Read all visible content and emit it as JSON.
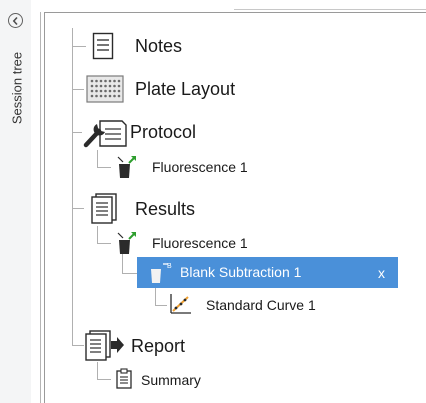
{
  "side_panel": {
    "label": "Session tree"
  },
  "tree": {
    "notes": "Notes",
    "plate_layout": "Plate Layout",
    "protocol": "Protocol",
    "protocol_child": "Fluorescence 1",
    "results": "Results",
    "results_child": "Fluorescence 1",
    "blank_subtraction": "Blank Subtraction 1",
    "blank_close": "x",
    "standard_curve": "Standard Curve 1",
    "report": "Report",
    "summary": "Summary"
  },
  "colors": {
    "selection": "#4a90d9",
    "accent_green": "#2e9e2e",
    "accent_orange": "#f0a030",
    "icon_dark": "#2b2b2b"
  }
}
